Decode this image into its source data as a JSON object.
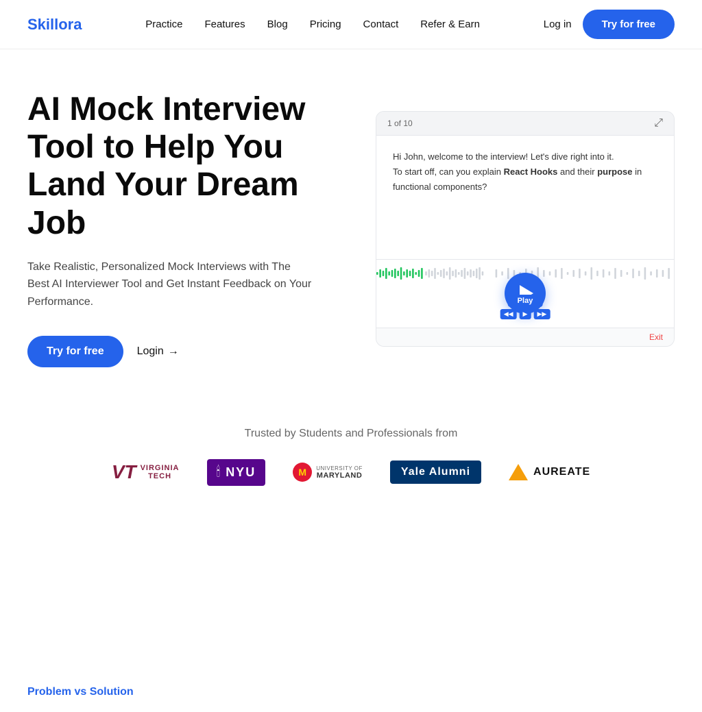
{
  "brand": {
    "name": "Skillora",
    "color": "#2563eb"
  },
  "nav": {
    "links": [
      {
        "label": "Practice",
        "href": "#"
      },
      {
        "label": "Features",
        "href": "#"
      },
      {
        "label": "Blog",
        "href": "#"
      },
      {
        "label": "Pricing",
        "href": "#"
      },
      {
        "label": "Contact",
        "href": "#"
      },
      {
        "label": "Refer & Earn",
        "href": "#"
      }
    ],
    "login_label": "Log in",
    "cta_label": "Try for free"
  },
  "hero": {
    "title": "AI Mock Interview Tool to Help You Land Your Dream Job",
    "subtitle": "Take Realistic, Personalized Mock Interviews with The Best AI Interviewer Tool and Get Instant Feedback on Your Performance.",
    "cta_label": "Try for free",
    "login_label": "Login"
  },
  "video_panel": {
    "counter": "1 of 10",
    "interview_text_1": "Hi John, welcome to the interview! Let's dive right into it.",
    "interview_text_2": "To start off, can you explain ",
    "interview_bold_1": "React Hooks",
    "interview_text_3": " and their ",
    "interview_bold_2": "purpose",
    "interview_text_4": " in functional components?",
    "play_label": "Play",
    "exit_label": "Exit"
  },
  "trusted": {
    "label": "Trusted by Students and Professionals from",
    "logos": [
      {
        "name": "Virginia Tech",
        "type": "vt"
      },
      {
        "name": "NYU",
        "type": "nyu"
      },
      {
        "name": "University of Maryland",
        "type": "umd"
      },
      {
        "name": "Yale Alumni",
        "type": "yale"
      },
      {
        "name": "Aureate",
        "type": "aureate"
      }
    ]
  },
  "problem_section": {
    "label": "Problem vs Solution"
  }
}
